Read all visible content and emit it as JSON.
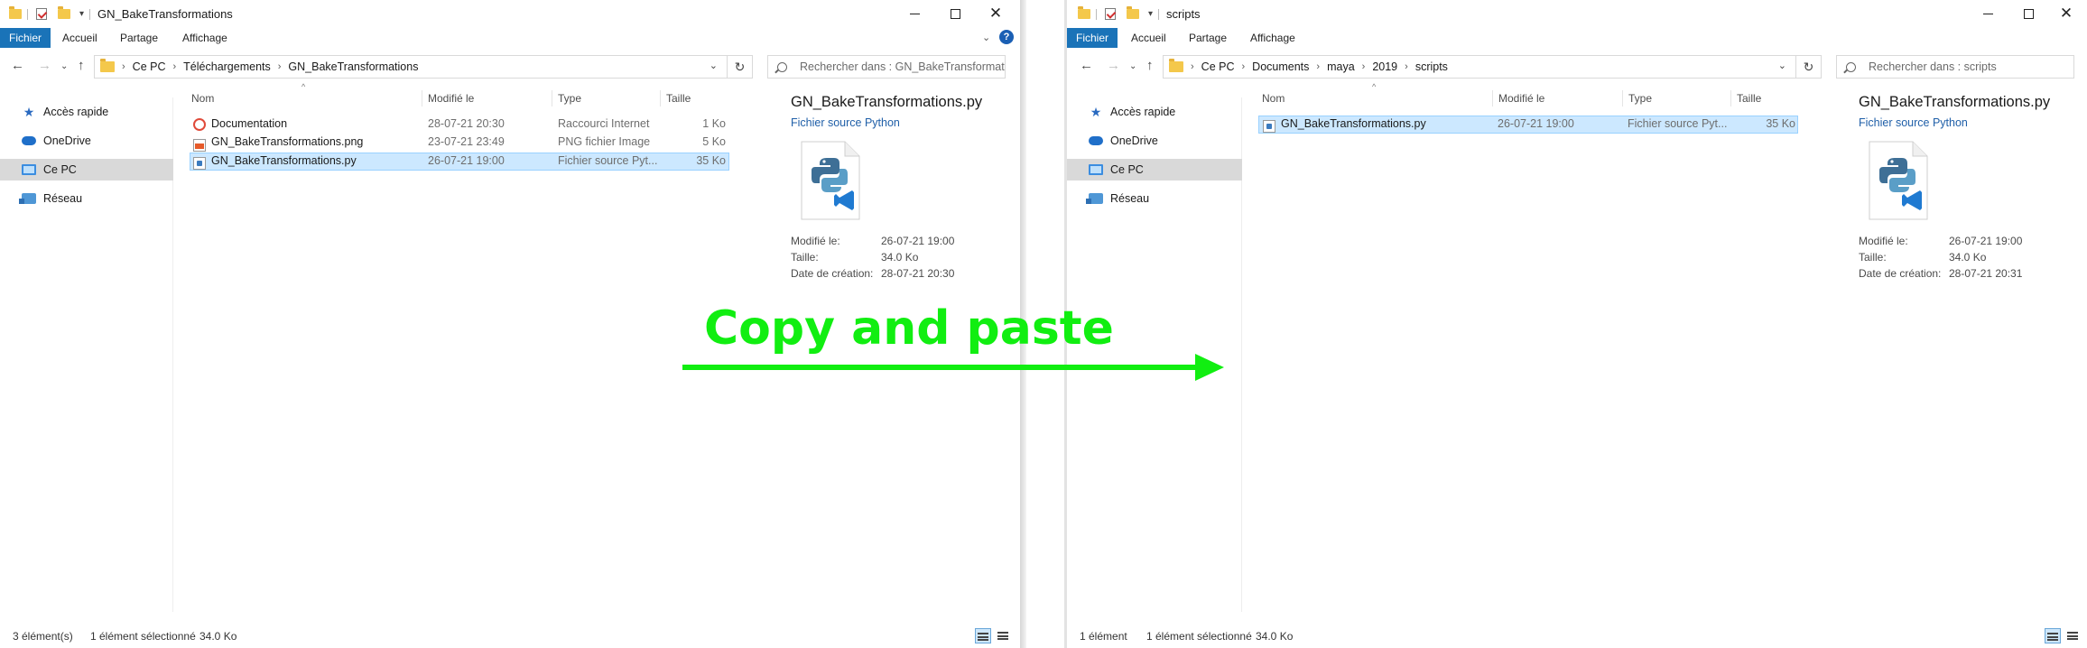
{
  "overlay": {
    "text": "Copy and paste",
    "color": "#11ee11"
  },
  "left": {
    "title": "GN_BakeTransformations",
    "menu": {
      "file": "Fichier",
      "home": "Accueil",
      "share": "Partage",
      "view": "Affichage"
    },
    "address": [
      "Ce PC",
      "Téléchargements",
      "GN_BakeTransformations"
    ],
    "search_placeholder": "Rechercher dans : GN_BakeTransformati...",
    "sidebar": [
      {
        "label": "Accès rapide",
        "icon": "star-icon"
      },
      {
        "label": "OneDrive",
        "icon": "cloud-icon"
      },
      {
        "label": "Ce PC",
        "icon": "computer-icon"
      },
      {
        "label": "Réseau",
        "icon": "network-icon"
      }
    ],
    "columns": {
      "name": "Nom",
      "modified": "Modifié le",
      "type": "Type",
      "size": "Taille"
    },
    "files": [
      {
        "name": "Documentation",
        "date": "28-07-21 20:30",
        "type": "Raccourci Internet",
        "size": "1 Ko",
        "icon": "internet-shortcut-icon"
      },
      {
        "name": "GN_BakeTransformations.png",
        "date": "23-07-21 23:49",
        "type": "PNG fichier Image",
        "size": "5 Ko",
        "icon": "png-file-icon"
      },
      {
        "name": "GN_BakeTransformations.py",
        "date": "26-07-21 19:00",
        "type": "Fichier source Pyt...",
        "size": "35 Ko",
        "icon": "python-file-icon",
        "selected": true
      }
    ],
    "preview": {
      "name": "GN_BakeTransformations.py",
      "type": "Fichier source Python",
      "modified_label": "Modifié le:",
      "modified": "26-07-21 19:00",
      "size_label": "Taille:",
      "size": "34.0 Ko",
      "created_label": "Date de création:",
      "created": "28-07-21 20:30"
    },
    "status": {
      "count": "3 élément(s)",
      "selected": "1 élément sélectionné",
      "size": "34.0 Ko"
    }
  },
  "right": {
    "title": "scripts",
    "menu": {
      "file": "Fichier",
      "home": "Accueil",
      "share": "Partage",
      "view": "Affichage"
    },
    "address": [
      "Ce PC",
      "Documents",
      "maya",
      "2019",
      "scripts"
    ],
    "search_placeholder": "Rechercher dans : scripts",
    "sidebar": [
      {
        "label": "Accès rapide",
        "icon": "star-icon"
      },
      {
        "label": "OneDrive",
        "icon": "cloud-icon"
      },
      {
        "label": "Ce PC",
        "icon": "computer-icon"
      },
      {
        "label": "Réseau",
        "icon": "network-icon"
      }
    ],
    "columns": {
      "name": "Nom",
      "modified": "Modifié le",
      "type": "Type",
      "size": "Taille"
    },
    "files": [
      {
        "name": "GN_BakeTransformations.py",
        "date": "26-07-21 19:00",
        "type": "Fichier source Pyt...",
        "size": "35 Ko",
        "icon": "python-file-icon",
        "selected": true
      }
    ],
    "preview": {
      "name": "GN_BakeTransformations.py",
      "type": "Fichier source Python",
      "modified_label": "Modifié le:",
      "modified": "26-07-21 19:00",
      "size_label": "Taille:",
      "size": "34.0 Ko",
      "created_label": "Date de création:",
      "created": "28-07-21 20:31"
    },
    "status": {
      "count": "1 élément",
      "selected": "1 élément sélectionné",
      "size": "34.0 Ko"
    }
  }
}
